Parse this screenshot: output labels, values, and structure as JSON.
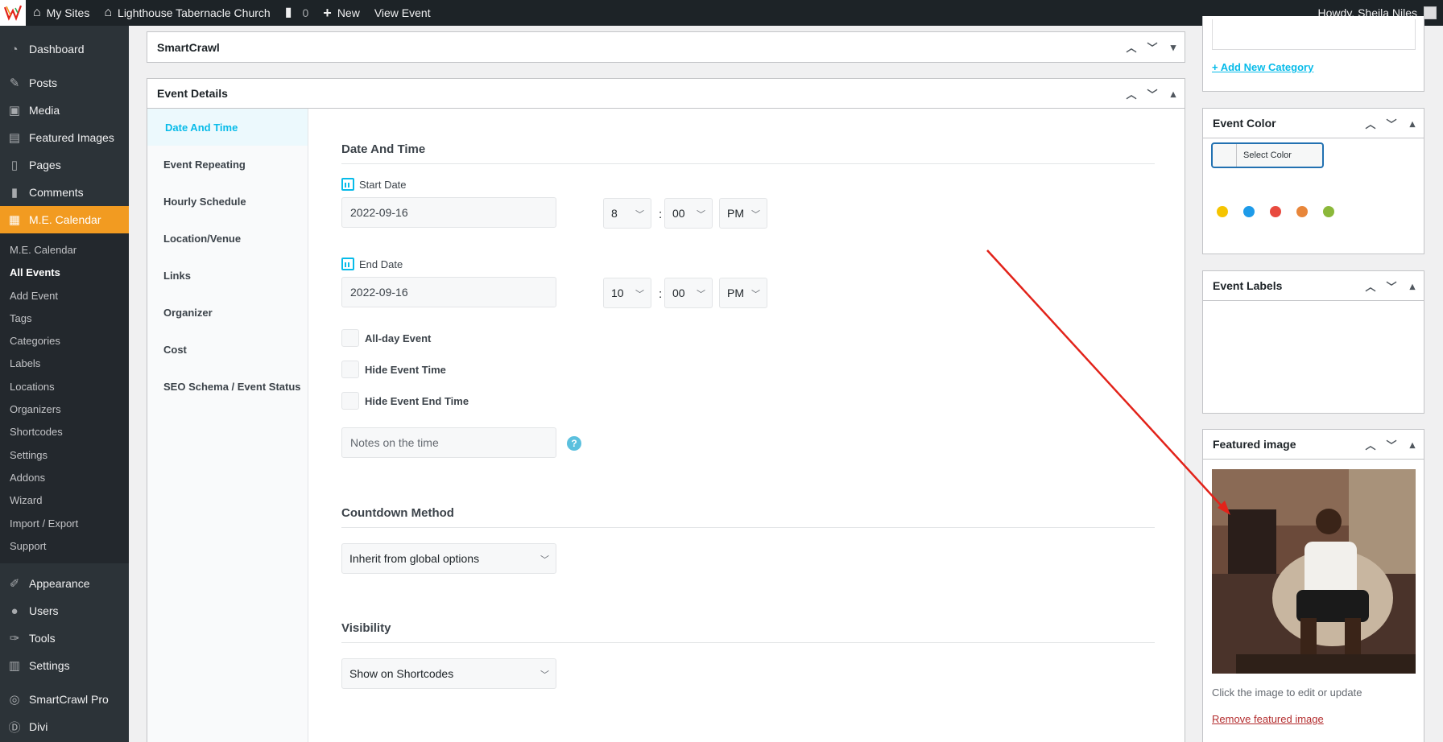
{
  "adminbar": {
    "my_sites": "My Sites",
    "site_name": "Lighthouse Tabernacle Church",
    "comments_count": "0",
    "new_label": "New",
    "view_event": "View Event",
    "howdy": "Howdy, Sheila Niles"
  },
  "menu": {
    "dashboard": "Dashboard",
    "posts": "Posts",
    "media": "Media",
    "featured_images": "Featured Images",
    "pages": "Pages",
    "comments": "Comments",
    "me_calendar": "M.E. Calendar",
    "submenu": [
      "M.E. Calendar",
      "All Events",
      "Add Event",
      "Tags",
      "Categories",
      "Labels",
      "Locations",
      "Organizers",
      "Shortcodes",
      "Settings",
      "Addons",
      "Wizard",
      "Import / Export",
      "Support"
    ],
    "appearance": "Appearance",
    "users": "Users",
    "tools": "Tools",
    "settings": "Settings",
    "smartcrawl_pro": "SmartCrawl Pro",
    "divi": "Divi"
  },
  "smartcrawl": {
    "title": "SmartCrawl"
  },
  "event_details": {
    "title": "Event Details",
    "tabs": [
      "Date And Time",
      "Event Repeating",
      "Hourly Schedule",
      "Location/Venue",
      "Links",
      "Organizer",
      "Cost",
      "SEO Schema / Event Status"
    ],
    "section_title": "Date And Time",
    "start_date_label": "Start Date",
    "start_date": "2022-09-16",
    "start_hour": "8",
    "start_minute": "00",
    "start_ampm": "PM",
    "end_date_label": "End Date",
    "end_date": "2022-09-16",
    "end_hour": "10",
    "end_minute": "00",
    "end_ampm": "PM",
    "colon": ":",
    "all_day": "All-day Event",
    "hide_time": "Hide Event Time",
    "hide_end_time": "Hide Event End Time",
    "notes_placeholder": "Notes on the time",
    "help": "?",
    "countdown_title": "Countdown Method",
    "countdown_value": "Inherit from global options",
    "visibility_title": "Visibility",
    "visibility_value": "Show on Shortcodes"
  },
  "sidebar": {
    "add_category": "+ Add New Category",
    "event_color_title": "Event Color",
    "select_color": "Select Color",
    "colors": [
      "#f5c400",
      "#1e9be9",
      "#e84a3f",
      "#e8863a",
      "#8bb83a"
    ],
    "event_labels_title": "Event Labels",
    "featured_image_title": "Featured image",
    "featured_hint": "Click the image to edit or update",
    "remove_featured": "Remove featured image"
  },
  "colors": {
    "accent": "#f29b21",
    "link": "#07bbe9",
    "sidebar_bg": "#2c3338",
    "adminbar_bg": "#1d2327"
  }
}
